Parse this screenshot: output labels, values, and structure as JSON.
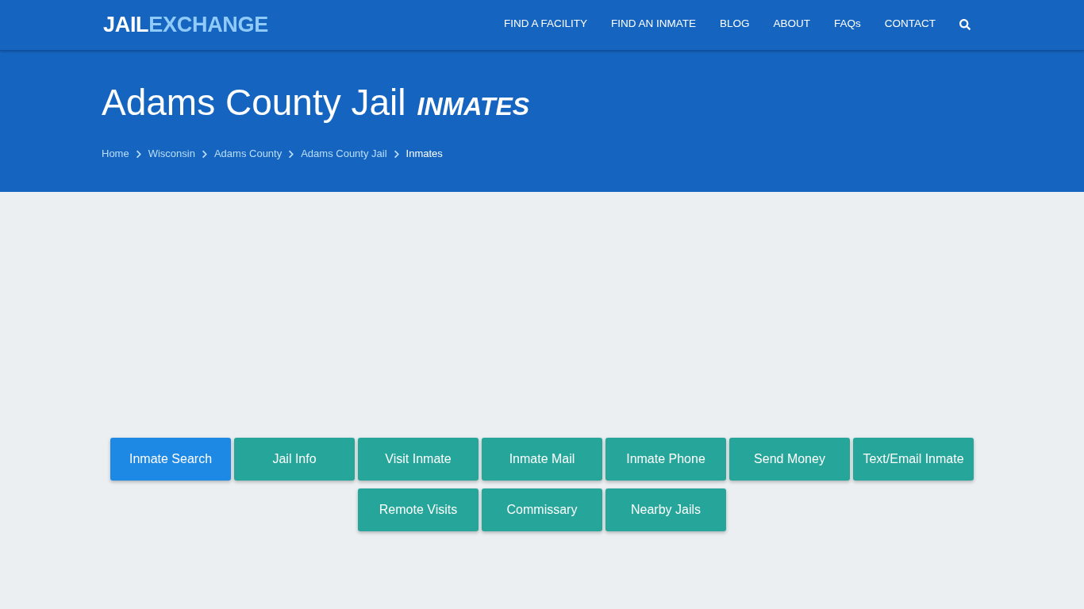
{
  "header": {
    "logo": {
      "part_1": "JAIL",
      "part_2": "EXCHANGE"
    },
    "nav": [
      "FIND A FACILITY",
      "FIND AN INMATE",
      "BLOG",
      "ABOUT",
      "FAQs",
      "CONTACT"
    ]
  },
  "hero": {
    "title": "Adams County Jail",
    "title_suffix": "INMATES",
    "breadcrumbs": [
      {
        "label": "Home",
        "current": false
      },
      {
        "label": "Wisconsin",
        "current": false
      },
      {
        "label": "Adams County",
        "current": false
      },
      {
        "label": "Adams County Jail",
        "current": false
      },
      {
        "label": "Inmates",
        "current": true
      }
    ]
  },
  "actions": [
    {
      "label": "Inmate Search",
      "selected": true
    },
    {
      "label": "Jail Info",
      "selected": false
    },
    {
      "label": "Visit Inmate",
      "selected": false
    },
    {
      "label": "Inmate Mail",
      "selected": false
    },
    {
      "label": "Inmate Phone",
      "selected": false
    },
    {
      "label": "Send Money",
      "selected": false
    },
    {
      "label": "Text/Email Inmate",
      "selected": false
    },
    {
      "label": "Remote Visits",
      "selected": false
    },
    {
      "label": "Commissary",
      "selected": false
    },
    {
      "label": "Nearby Jails",
      "selected": false
    }
  ]
}
